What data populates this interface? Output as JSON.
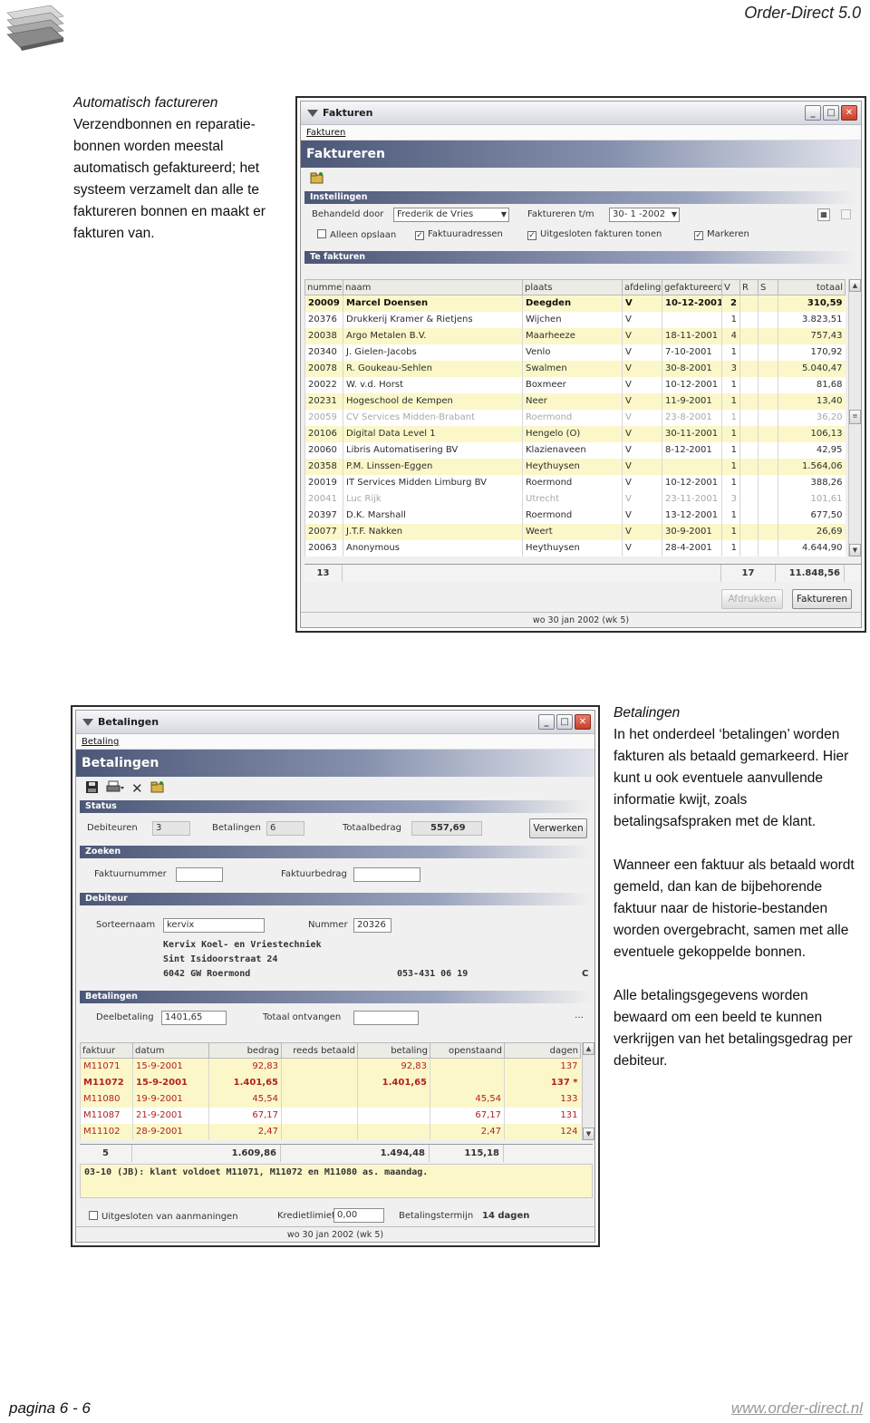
{
  "header": {
    "title": "Order-Direct 5.0"
  },
  "footer": {
    "page": "pagina 6 - 6",
    "url": "www.order-direct.nl"
  },
  "intro": {
    "heading": "Automatisch factureren",
    "body": "Verzendbonnen en reparatie-bonnen worden meestal automatisch gefaktureerd; het systeem verzamelt dan alle te faktureren bonnen en maakt er fakturen van."
  },
  "betalingen_text": {
    "heading": "Betalingen",
    "p1": "In het onderdeel ‘betalingen’ worden fakturen als betaald gemarkeerd. Hier kunt u ook eventuele aanvullende informatie kwijt, zoals betalingsafspraken met de klant.",
    "p2": "Wanneer een faktuur als betaald wordt gemeld, dan kan de bijbehorende faktuur naar de historie-bestanden worden overgebracht, samen met alle eventuele gekoppelde bonnen.",
    "p3": "Alle betalingsgegevens worden bewaard om een beeld te kunnen verkrijgen van het betalingsgedrag per debiteur."
  },
  "fakt_window": {
    "title": "Fakturen",
    "menu": "Fakturen",
    "header": "Faktureren",
    "section_settings": "Instellingen",
    "behandeld_label": "Behandeld door",
    "behandeld_value": "Frederik de Vries",
    "tm_label": "Faktureren t/m",
    "tm_value": "30- 1 -2002",
    "cb_alleen": "Alleen opslaan",
    "cb_adressen": "Faktuuradressen",
    "cb_uitgesloten": "Uitgesloten fakturen tonen",
    "cb_markeren": "Markeren",
    "section_list": "Te fakturen",
    "columns": [
      "nummer",
      "naam",
      "plaats",
      "afdeling",
      "gefaktureerd",
      "V",
      "R",
      "S",
      "totaal"
    ],
    "rows": [
      [
        "20009",
        "Marcel Doensen",
        "Deegden",
        "V",
        "10-12-2001",
        "2",
        "",
        "",
        "310,59"
      ],
      [
        "20376",
        "Drukkerij Kramer & Rietjens",
        "Wijchen",
        "V",
        "",
        "1",
        "",
        "",
        "3.823,51"
      ],
      [
        "20038",
        "Argo Metalen B.V.",
        "Maarheeze",
        "V",
        "18-11-2001",
        "4",
        "",
        "",
        "757,43"
      ],
      [
        "20340",
        "J. Gielen-Jacobs",
        "Venlo",
        "V",
        "7-10-2001",
        "1",
        "",
        "",
        "170,92"
      ],
      [
        "20078",
        "R. Goukeau-Sehlen",
        "Swalmen",
        "V",
        "30-8-2001",
        "3",
        "",
        "",
        "5.040,47"
      ],
      [
        "20022",
        "W. v.d. Horst",
        "Boxmeer",
        "V",
        "10-12-2001",
        "1",
        "",
        "",
        "81,68"
      ],
      [
        "20231",
        "Hogeschool de Kempen",
        "Neer",
        "V",
        "11-9-2001",
        "1",
        "",
        "",
        "13,40"
      ],
      [
        "20059",
        "CV Services Midden-Brabant",
        "Roermond",
        "V",
        "23-8-2001",
        "1",
        "",
        "",
        "36,20"
      ],
      [
        "20106",
        "Digital Data Level 1",
        "Hengelo (O)",
        "V",
        "30-11-2001",
        "1",
        "",
        "",
        "106,13"
      ],
      [
        "20060",
        "Libris Automatisering BV",
        "Klazienaveen",
        "V",
        "8-12-2001",
        "1",
        "",
        "",
        "42,95"
      ],
      [
        "20358",
        "P.M. Linssen-Eggen",
        "Heythuysen",
        "V",
        "",
        "1",
        "",
        "",
        "1.564,06"
      ],
      [
        "20019",
        "IT Services Midden Limburg BV",
        "Roermond",
        "V",
        "10-12-2001",
        "1",
        "",
        "",
        "388,26"
      ],
      [
        "20041",
        "Luc Rijk",
        "Utrecht",
        "V",
        "23-11-2001",
        "3",
        "",
        "",
        "101,61"
      ],
      [
        "20397",
        "D.K. Marshall",
        "Roermond",
        "V",
        "13-12-2001",
        "1",
        "",
        "",
        "677,50"
      ],
      [
        "20077",
        "J.T.F. Nakken",
        "Weert",
        "V",
        "30-9-2001",
        "1",
        "",
        "",
        "26,69"
      ],
      [
        "20063",
        "Anonymous",
        "Heythuysen",
        "V",
        "28-4-2001",
        "1",
        "",
        "",
        "4.644,90"
      ]
    ],
    "total_count": "13",
    "total_v": "17",
    "total_amount": "11.848,56",
    "btn_afdrukken": "Afdrukken",
    "btn_faktureren": "Faktureren",
    "status": "wo 30 jan 2002 (wk 5)"
  },
  "bet_window": {
    "title": "Betalingen",
    "menu": "Betaling",
    "header": "Betalingen",
    "section_status": "Status",
    "deb_label": "Debiteuren",
    "deb_value": "3",
    "bet_label": "Betalingen",
    "bet_value": "6",
    "tot_label": "Totaalbedrag",
    "tot_value": "557,69",
    "btn_verwerken": "Verwerken",
    "section_zoeken": "Zoeken",
    "faktnr_label": "Faktuurnummer",
    "faktbedrag_label": "Faktuurbedrag",
    "section_debiteur": "Debiteur",
    "sorteernaam_label": "Sorteernaam",
    "sorteernaam_value": "kervix",
    "nummer_label": "Nummer",
    "nummer_value": "20326",
    "addr_name": "Kervix Koel- en Vriestechniek",
    "addr_street": "Sint Isidoorstraat 24",
    "addr_city": "6042 GW  Roermond",
    "phone": "053-431 06 19",
    "flag": "C",
    "section_betalingen": "Betalingen",
    "deelbetaling_label": "Deelbetaling",
    "deelbetaling_value": "1401,65",
    "ontvangen_label": "Totaal ontvangen",
    "columns": [
      "faktuur",
      "datum",
      "bedrag",
      "reeds betaald",
      "betaling",
      "openstaand",
      "dagen"
    ],
    "rows": [
      [
        "M11071",
        "15-9-2001",
        "92,83",
        "",
        "92,83",
        "",
        "137"
      ],
      [
        "M11072",
        "15-9-2001",
        "1.401,65",
        "",
        "1.401,65",
        "",
        "137 *"
      ],
      [
        "M11080",
        "19-9-2001",
        "45,54",
        "",
        "",
        "45,54",
        "133"
      ],
      [
        "M11087",
        "21-9-2001",
        "67,17",
        "",
        "",
        "67,17",
        "131"
      ],
      [
        "M11102",
        "28-9-2001",
        "2,47",
        "",
        "",
        "2,47",
        "124"
      ]
    ],
    "totals": [
      "5",
      "1.609,86",
      "1.494,48",
      "115,18"
    ],
    "memo": "03-10 (JB): klant voldoet M11071, M11072 en M11080 as. maandag.",
    "cb_uitgesloten": "Uitgesloten van aanmaningen",
    "krediet_label": "Kredietlimiet",
    "krediet_value": "0,00",
    "termijn_label": "Betalingstermijn",
    "termijn_value": "14 dagen",
    "status": "wo 30 jan 2002 (wk 5)"
  }
}
